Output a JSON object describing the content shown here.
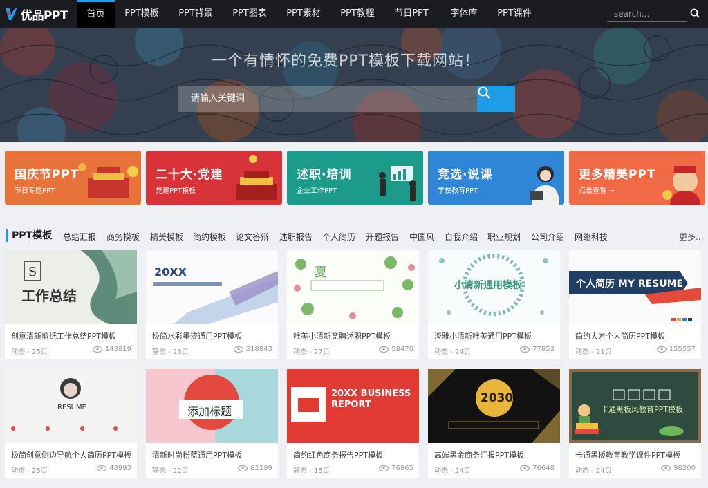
{
  "brand": {
    "name": "优品PPT"
  },
  "nav": {
    "items": [
      "首页",
      "PPT模板",
      "PPT背景",
      "PPT图表",
      "PPT素材",
      "PPT教程",
      "节日PPT",
      "字体库",
      "PPT课件"
    ],
    "search_placeholder": "search..."
  },
  "hero": {
    "title": "一个有情怀的免费PPT模板下载网站！",
    "search_placeholder": "请输入关键词"
  },
  "promos": [
    {
      "title": "国庆节PPT",
      "sub": "节日专题PPT",
      "color": "#e8733a"
    },
    {
      "title": "二十大·党建",
      "sub": "党建PPT模板",
      "color": "#d9333a"
    },
    {
      "title": "述职·培训",
      "sub": "企业工作PPT",
      "color": "#1c9a8a"
    },
    {
      "title": "竞选·说课",
      "sub": "学校教育PPT",
      "color": "#2f86d6"
    },
    {
      "title": "更多精美PPT",
      "sub": "点击查看 →",
      "color": "#f06a45"
    }
  ],
  "section": {
    "title": "PPT模板",
    "categories": [
      "总结汇报",
      "商务模板",
      "精美模板",
      "简约模板",
      "论文答辩",
      "述职报告",
      "个人简历",
      "开题报告",
      "中国风",
      "自我介绍",
      "职业规划",
      "公司介绍",
      "网络科技"
    ],
    "more": "更多..."
  },
  "cards": [
    {
      "title": "创意清新剪纸工作总结PPT模板",
      "type": "动态",
      "pages": "25页",
      "views": "143819",
      "thumb_text": "工作总结"
    },
    {
      "title": "极简水彩墨迹通用PPT模板",
      "type": "静态",
      "pages": "26页",
      "views": "218843",
      "thumb_text": "20XX"
    },
    {
      "title": "唯美小清新竞聘述职PPT模板",
      "type": "动态",
      "pages": "27页",
      "views": "58470",
      "thumb_text": "夏"
    },
    {
      "title": "淡雅小清新唯美通用PPT模板",
      "type": "动态",
      "pages": "24页",
      "views": "77853",
      "thumb_text": "小清新通用模板"
    },
    {
      "title": "简约大方个人简历PPT模板",
      "type": "动态",
      "pages": "21页",
      "views": "155557",
      "thumb_text": "个人简历 MY RESUME"
    },
    {
      "title": "极简创意侧边导航个人简历PPT模板",
      "type": "动态",
      "pages": "25页",
      "views": "48993",
      "thumb_text": "RESUME"
    },
    {
      "title": "清新时尚粉蓝通用PPT模板",
      "type": "静态",
      "pages": "22页",
      "views": "82199",
      "thumb_text": "添加标题"
    },
    {
      "title": "简约红色商务报告PPT模板",
      "type": "静态",
      "pages": "15页",
      "views": "76965",
      "thumb_text": "20XX BUSINESS REPORT"
    },
    {
      "title": "高端黑金商务汇报PPT模板",
      "type": "动态",
      "pages": "24页",
      "views": "76648",
      "thumb_text": "2030"
    },
    {
      "title": "卡通黑板教育教学课件PPT模板",
      "type": "动态",
      "pages": "24页",
      "views": "98200",
      "thumb_text": "卡通黑板风教育PPT模板"
    }
  ],
  "accent": "#1e9de6"
}
